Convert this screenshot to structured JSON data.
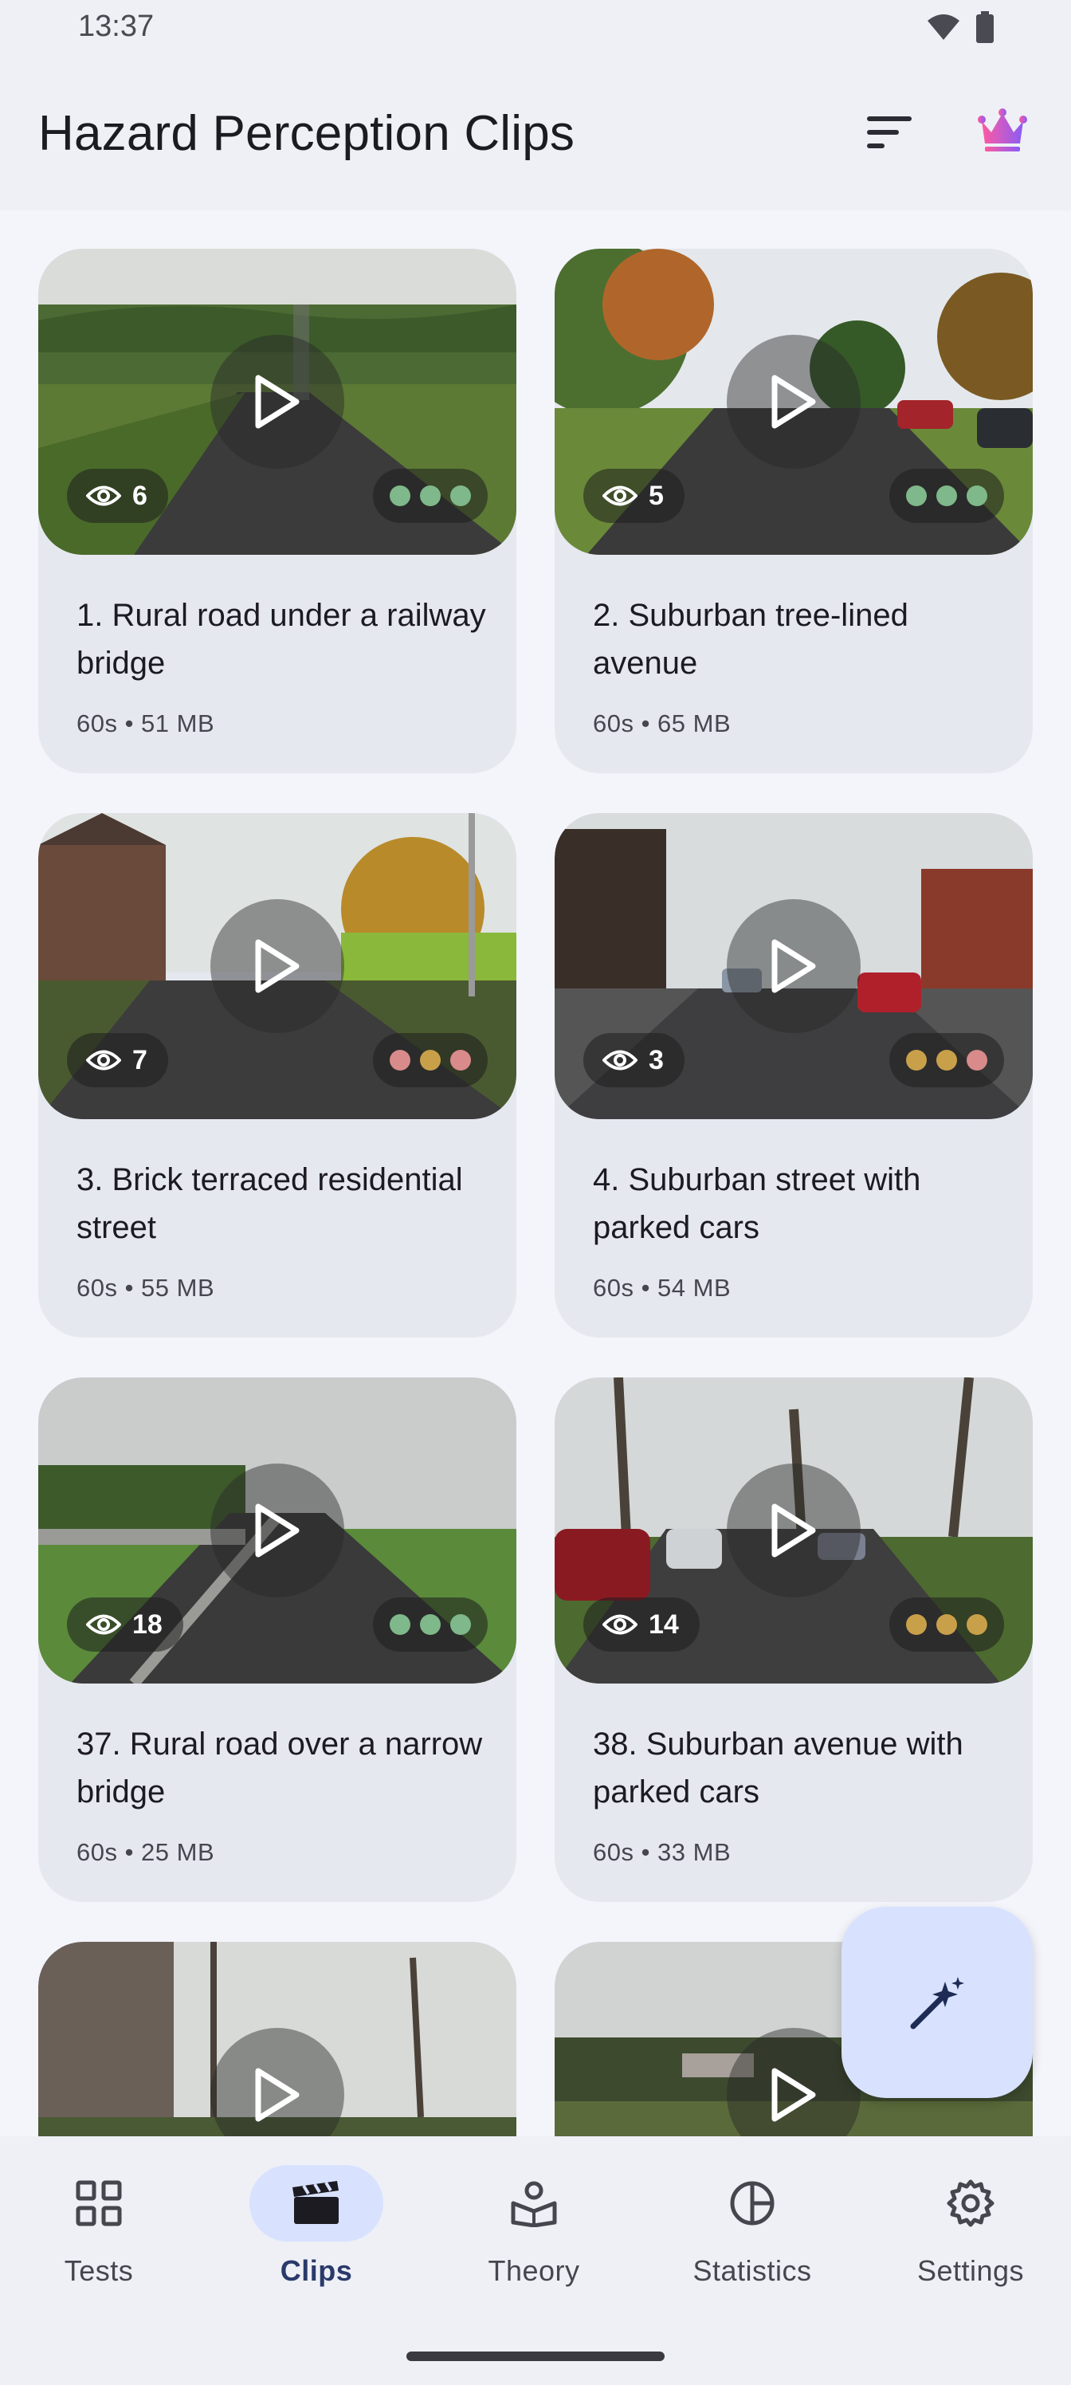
{
  "status_bar": {
    "time": "13:37"
  },
  "app_bar": {
    "title": "Hazard Perception Clips",
    "sort_icon": "sort-icon",
    "premium_icon": "crown-icon",
    "crown_gradient": [
      "#ff5aa0",
      "#8a5cf6"
    ]
  },
  "clips": [
    {
      "title": "1. Rural road under a railway bridge",
      "meta": "60s • 51 MB",
      "views": "6",
      "dots": [
        "#7fb88a",
        "#7fb88a",
        "#7fb88a"
      ]
    },
    {
      "title": "2. Suburban tree-lined avenue",
      "meta": "60s • 65 MB",
      "views": "5",
      "dots": [
        "#7fb88a",
        "#7fb88a",
        "#7fb88a"
      ]
    },
    {
      "title": "3. Brick terraced residential street",
      "meta": "60s • 55 MB",
      "views": "7",
      "dots": [
        "#d98a8a",
        "#c9a04a",
        "#d98a8a"
      ]
    },
    {
      "title": "4. Suburban street with parked cars",
      "meta": "60s • 54 MB",
      "views": "3",
      "dots": [
        "#c9a04a",
        "#c9a04a",
        "#d98a8a"
      ]
    },
    {
      "title": "37. Rural road over a narrow bridge",
      "meta": "60s • 25 MB",
      "views": "18",
      "dots": [
        "#7fb88a",
        "#7fb88a",
        "#7fb88a"
      ]
    },
    {
      "title": "38. Suburban avenue with parked cars",
      "meta": "60s • 33 MB",
      "views": "14",
      "dots": [
        "#c9a04a",
        "#c9a04a",
        "#c9a04a"
      ]
    }
  ],
  "fab": {
    "icon": "magic-wand-icon"
  },
  "bottom_nav": {
    "items": [
      {
        "label": "Tests",
        "icon": "grid-icon"
      },
      {
        "label": "Clips",
        "icon": "clapperboard-icon",
        "active": true
      },
      {
        "label": "Theory",
        "icon": "book-person-icon"
      },
      {
        "label": "Statistics",
        "icon": "pie-chart-icon"
      },
      {
        "label": "Settings",
        "icon": "gear-icon"
      }
    ]
  },
  "colors": {
    "background": "#f4f5fb",
    "surface": "#eef0f6",
    "card": "#e6e8f0",
    "accent_container": "#d8e2ff"
  }
}
